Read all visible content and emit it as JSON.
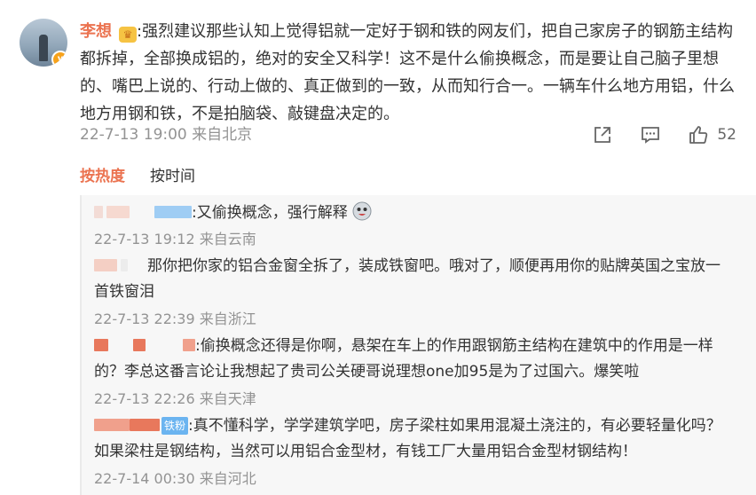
{
  "post": {
    "author": "李想",
    "text": ":强烈建议那些认知上觉得铝就一定好于钢和铁的网友们，把自己家房子的钢筋主结构都拆掉，全部换成铝的，绝对的安全又科学！这不是什么偷换概念，而是要让自己脑子里想的、嘴巴上说的、行动上做的、真正做到的一致，从而知行合一。一辆车什么地方用铝，什么地方用钢和铁，不是拍脑袋、敲键盘决定的。",
    "timestamp": "22-7-13 19:00 来自北京",
    "like_count": "52",
    "icons": [
      "share-icon",
      "comment-icon",
      "like-icon"
    ]
  },
  "sort_tabs": {
    "hot": "按热度",
    "time": "按时间"
  },
  "comments": [
    {
      "text": ":又偷换概念，强行解释",
      "timestamp": "22-7-13 19:12 来自云南"
    },
    {
      "text": "那你把你家的铝合金窗全拆了，装成铁窗吧。哦对了，顺便再用你的贴牌英国之宝放一首铁窗泪",
      "timestamp": "22-7-13 22:39 来自浙江"
    },
    {
      "text": ":偷换概念还得是你啊，悬架在车上的作用跟钢筋主结构在建筑中的作用是一样的？李总这番言论让我想起了贵司公关硬哥说理想one加95是为了过国六。爆笑啦",
      "timestamp": "22-7-13 22:26 来自天津"
    },
    {
      "fan_tag": "铁粉",
      "text": ":真不懂科学，学学建筑学吧，房子梁柱如果用混凝土浇注的，有必要轻量化吗？如果梁柱是钢结构，当然可以用铝合金型材，有钱工厂大量用铝合金型材钢结构！",
      "timestamp": "22-7-14 00:30 来自河北"
    }
  ],
  "colors": {
    "accent": "#eb7350",
    "meta": "#939393",
    "comment_bg": "#f7f7f7",
    "fan_tag": "#6bb4f0"
  }
}
